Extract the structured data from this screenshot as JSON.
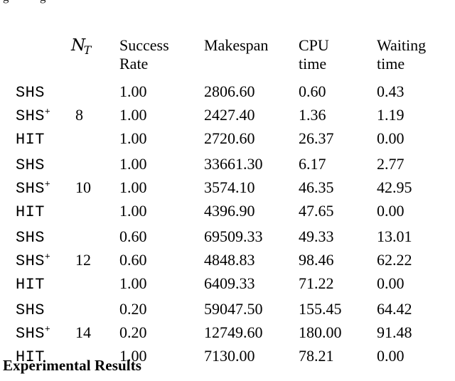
{
  "page": {
    "clipped_top_text": {
      "fragment_left": "g",
      "fragment_right": "g"
    },
    "caption": "Experimental Results"
  },
  "table": {
    "columns": [
      {
        "key": "method",
        "label": "",
        "label_line1": "",
        "label_line2": ""
      },
      {
        "key": "nt",
        "label": "N_T",
        "symbol_base": "N",
        "symbol_sub": "T"
      },
      {
        "key": "success",
        "label": "Success Rate",
        "label_line1": "Success",
        "label_line2": "Rate"
      },
      {
        "key": "makespan",
        "label": "Makespan",
        "label_line1": "Makespan",
        "label_line2": ""
      },
      {
        "key": "cpu",
        "label": "CPU time",
        "label_line1": "CPU",
        "label_line2": "time"
      },
      {
        "key": "waiting",
        "label": "Waiting time",
        "label_line1": "Waiting",
        "label_line2": "time"
      }
    ],
    "blocks": [
      {
        "nt": "8",
        "rows": [
          {
            "method": "SHS",
            "method_sup": "",
            "success": "1.00",
            "makespan": "2806.60",
            "cpu": "0.60",
            "waiting": "0.43",
            "bold": false
          },
          {
            "method": "SHS",
            "method_sup": "+",
            "success": "1.00",
            "makespan": "2427.40",
            "cpu": "1.36",
            "waiting": "1.19",
            "bold": false
          },
          {
            "method": "HIT",
            "method_sup": "",
            "success": "1.00",
            "makespan": "2720.60",
            "cpu": "26.37",
            "waiting": "0.00",
            "bold": false
          }
        ]
      },
      {
        "nt": "10",
        "rows": [
          {
            "method": "SHS",
            "method_sup": "",
            "success": "1.00",
            "makespan": "33661.30",
            "cpu": "6.17",
            "waiting": "2.77",
            "bold": false
          },
          {
            "method": "SHS",
            "method_sup": "+",
            "success": "1.00",
            "makespan": "3574.10",
            "cpu": "46.35",
            "waiting": "42.95",
            "bold": false
          },
          {
            "method": "HIT",
            "method_sup": "",
            "success": "1.00",
            "makespan": "4396.90",
            "cpu": "47.65",
            "waiting": "0.00",
            "bold": false
          }
        ]
      },
      {
        "nt": "12",
        "rows": [
          {
            "method": "SHS",
            "method_sup": "",
            "success": "0.60",
            "makespan": "69509.33",
            "cpu": "49.33",
            "waiting": "13.01",
            "bold": false
          },
          {
            "method": "SHS",
            "method_sup": "+",
            "success": "0.60",
            "makespan": "4848.83",
            "cpu": "98.46",
            "waiting": "62.22",
            "bold": false
          },
          {
            "method": "HIT",
            "method_sup": "",
            "success": "1.00",
            "makespan": "6409.33",
            "cpu": "71.22",
            "waiting": "0.00",
            "bold": false
          }
        ]
      },
      {
        "nt": "14",
        "rows": [
          {
            "method": "SHS",
            "method_sup": "",
            "success": "0.20",
            "makespan": "59047.50",
            "cpu": "155.45",
            "waiting": "64.42",
            "bold": false
          },
          {
            "method": "SHS",
            "method_sup": "+",
            "success": "0.20",
            "makespan": "12749.60",
            "cpu": "180.00",
            "waiting": "91.48",
            "bold": false
          },
          {
            "method": "HIT",
            "method_sup": "",
            "success": "1.00",
            "makespan": "7130.00",
            "cpu": "78.21",
            "waiting": "0.00",
            "bold": true
          }
        ]
      }
    ]
  }
}
